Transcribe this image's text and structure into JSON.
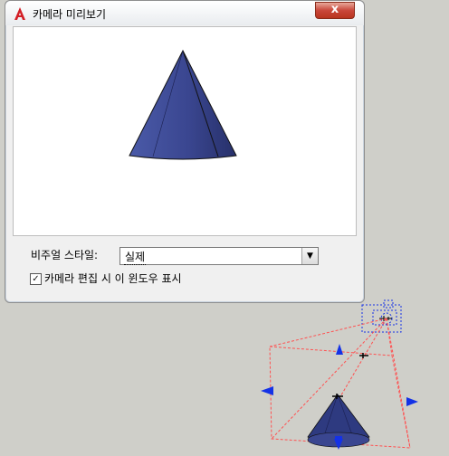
{
  "window": {
    "title": "카메라 미리보기",
    "close_label": "x"
  },
  "controls": {
    "visual_style_label": "비주얼 스타일:",
    "visual_style_value": "실제",
    "show_window_label": "카메라 편집 시 이 윈도우 표시",
    "show_window_checked": true
  },
  "colors": {
    "cone_fill": "#3b4a92",
    "frustum_line": "#ff5050",
    "grip_blue": "#1432e6"
  }
}
